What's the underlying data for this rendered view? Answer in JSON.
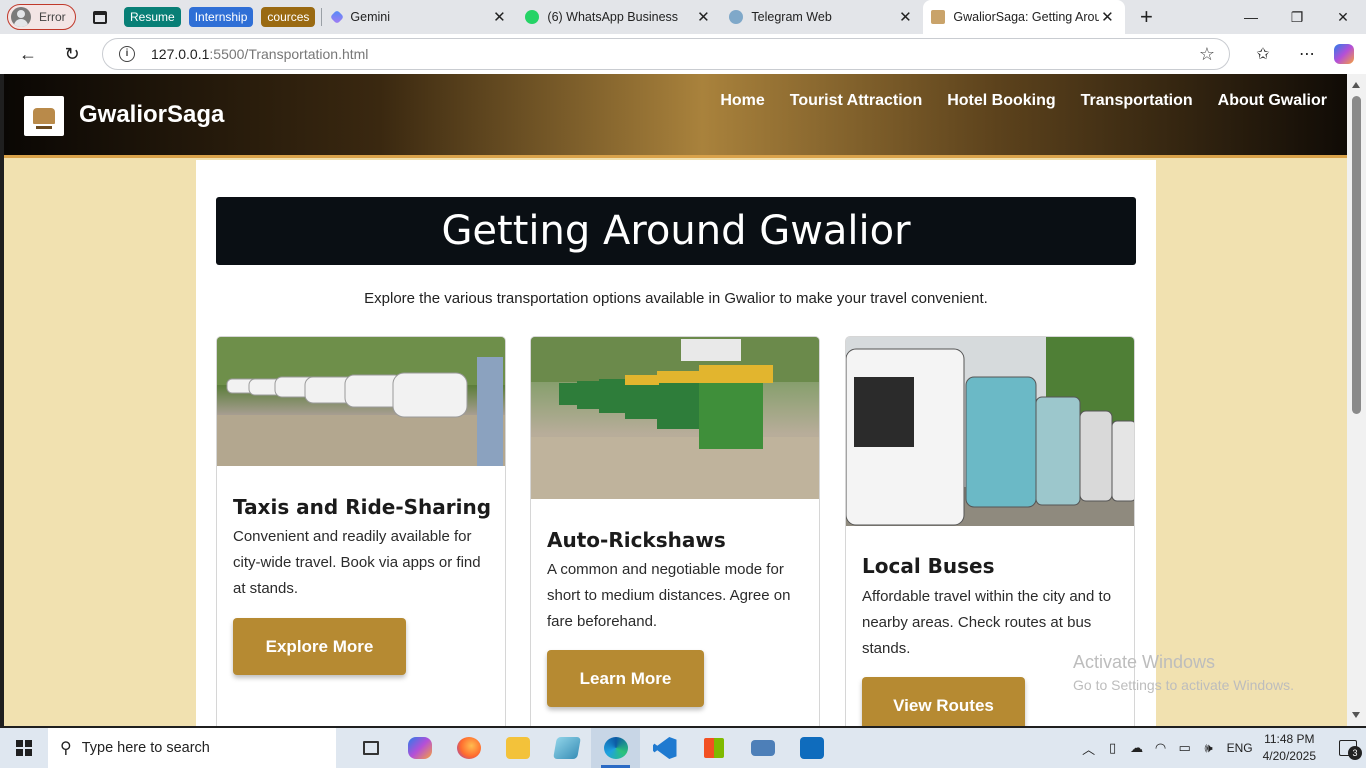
{
  "browser": {
    "profile": {
      "label": "Error"
    },
    "tab_groups": [
      {
        "label": "Resume",
        "color": "#087f76"
      },
      {
        "label": "Internship",
        "color": "#2f6fd6"
      },
      {
        "label": "cources",
        "color": "#9a6a12"
      }
    ],
    "tabs": [
      {
        "title": "Gemini",
        "icon": "gemini-icon"
      },
      {
        "title": "(6) WhatsApp Business",
        "icon": "whatsapp-icon"
      },
      {
        "title": "Telegram Web",
        "icon": "telegram-icon"
      },
      {
        "title": "GwaliorSaga: Getting Around",
        "icon": "site-favicon",
        "active": true
      }
    ],
    "address": {
      "url_host": "127.0.0.1",
      "url_rest": ":5500/Transportation.html"
    }
  },
  "site": {
    "brand": "GwaliorSaga",
    "nav": [
      "Home",
      "Tourist Attraction",
      "Hotel Booking",
      "Transportation",
      "About Gwalior"
    ],
    "hero_title": "Getting Around Gwalior",
    "intro": "Explore the various transportation options available in Gwalior to make your travel convenient.",
    "cards": [
      {
        "title": "Taxis and Ride-Sharing",
        "text": "Convenient and readily available for city-wide travel. Book via apps or find at stands.",
        "button": "Explore More"
      },
      {
        "title": "Auto-Rickshaws",
        "text": "A common and negotiable mode for short to medium distances. Agree on fare beforehand.",
        "button": "Learn More"
      },
      {
        "title": "Local Buses",
        "text": "Affordable travel within the city and to nearby areas. Check routes at bus stands.",
        "button": "View Routes"
      }
    ],
    "colors": {
      "accent": "#b68a32",
      "page_bg": "#f1e1b0",
      "hero_bg": "#0a0f14"
    }
  },
  "watermark": {
    "line1": "Activate Windows",
    "line2": "Go to Settings to activate Windows."
  },
  "taskbar": {
    "search_placeholder": "Type here to search",
    "language": "ENG",
    "time": "11:48 PM",
    "date": "4/20/2025",
    "notification_count": "3"
  }
}
